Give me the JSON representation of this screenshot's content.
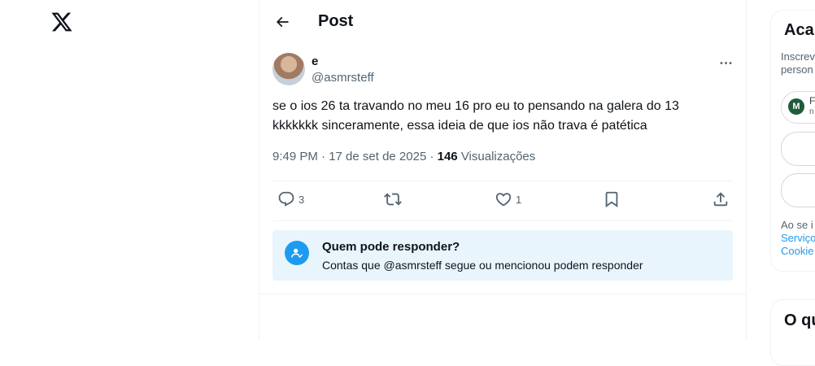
{
  "nav": {
    "logo_icon": "x-logo"
  },
  "header": {
    "back_icon": "arrow-left-icon",
    "title": "Post"
  },
  "post": {
    "display_name": "e",
    "handle": "@asmrsteff",
    "text": "se o ios 26 ta travando no meu 16 pro eu to pensando na galera do 13\nkkkkkkk sinceramente, essa ideia de que ios não trava é patética",
    "time": "9:49 PM · 17 de set de 2025 · ",
    "views_count": "146",
    "views_label": " Visualizações",
    "more_icon": "more-horizontal-icon"
  },
  "actions": {
    "replies": "3",
    "reposts": "",
    "likes": "1",
    "reply_icon": "reply-icon",
    "repost_icon": "repost-icon",
    "like_icon": "heart-icon",
    "bookmark_icon": "bookmark-icon",
    "share_icon": "share-icon"
  },
  "reply_restriction": {
    "title": "Quem pode responder?",
    "subtitle": "Contas que @asmrsteff segue ou mencionou podem responder",
    "icon": "mention-icon"
  },
  "sidebar": {
    "signup_title": "Aca",
    "signup_text": "Inscrev\nperson",
    "google_avatar": "M",
    "google_name": "F",
    "google_sub": "n",
    "legal_prefix": "Ao se i",
    "legal_link1": "Serviço",
    "legal_link2": "Cookie",
    "trends_title": "O qu"
  },
  "colors": {
    "accent": "#1d9bf0",
    "muted": "#536471",
    "reply_box_bg": "#e8f5fd"
  }
}
